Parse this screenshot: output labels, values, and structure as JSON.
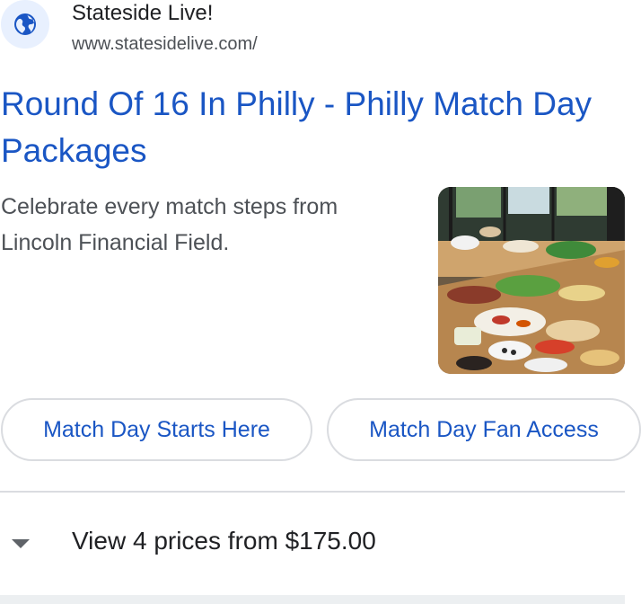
{
  "result": {
    "site_name": "Stateside Live!",
    "site_url": "www.statesidelive.com/",
    "favicon_icon": "globe-icon",
    "title": "Round Of 16 In Philly - Philly Match Day Packages",
    "snippet": "Celebrate every match steps from Lincoln Financial Field.",
    "thumbnail_icon": "food-spread-photo"
  },
  "chips": [
    {
      "label": "Match Day Starts Here"
    },
    {
      "label": "Match Day Fan Access"
    }
  ],
  "prices": {
    "label": "View 4 prices from $175.00",
    "toggle_icon": "caret-down-icon"
  },
  "colors": {
    "link": "#1a56c4",
    "text": "#202124",
    "muted": "#4d5156",
    "border": "#dadce0",
    "favicon_bg": "#e8f0fe"
  }
}
